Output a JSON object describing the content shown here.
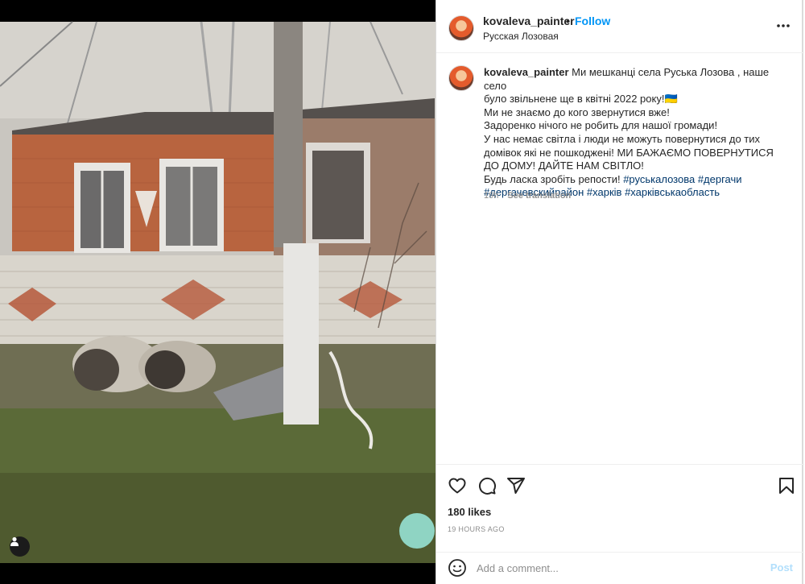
{
  "post": {
    "username": "kovaleva_painter",
    "separator": "•",
    "follow_label": "Follow",
    "location": "Русская Лозовая",
    "caption": {
      "lines": [
        "Ми мешканці села Руська Лозова , наше село",
        "було звільнене ще в квітні 2022 року!🇺🇦",
        "Ми не знаємо до кого звернутися вже!",
        "Задоренко нічого не робить для нашої громади!",
        "У нас немає світла і люди не можуть повернутися до тих",
        "домівок які не пошкоджені! МИ БАЖАЄМО ПОВЕРНУТИСЯ",
        "ДО ДОМУ! ДАЙТЕ НАМ СВІТЛО!",
        "Будь ласка зробіть репости!"
      ],
      "hashtags": [
        "#руськалозова",
        "#дергачи",
        "#дергачевскийрайон",
        "#харків",
        "#харківськаобласть"
      ]
    },
    "age": "19h",
    "see_translation": "See translation",
    "likes": "180 likes",
    "timestamp": "19 HOURS AGO",
    "comment_placeholder": "Add a comment...",
    "post_label": "Post"
  },
  "icons": {
    "more": "more-options-icon",
    "like": "heart-icon",
    "comment": "comment-icon",
    "share": "share-icon",
    "save": "bookmark-icon",
    "emoji": "emoji-icon",
    "tagged": "user-tag-icon"
  },
  "colors": {
    "accent": "#0095f6",
    "hashtag": "#00376b",
    "muted": "#8e8e8e",
    "post_disabled": "#b2dffc"
  }
}
